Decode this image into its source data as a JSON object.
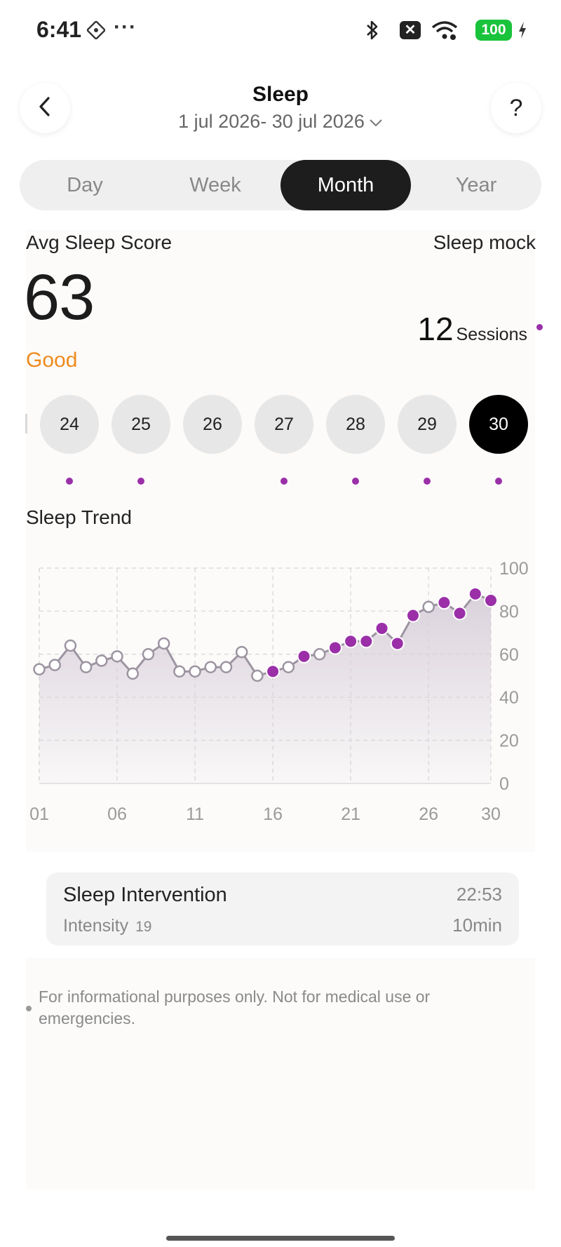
{
  "status_bar": {
    "time": "6:41",
    "more": "···",
    "battery": "100"
  },
  "header": {
    "title": "Sleep",
    "date_range": "1 jul 2026- 30 jul 2026",
    "help": "?"
  },
  "tabs": [
    {
      "label": "Day",
      "active": false
    },
    {
      "label": "Week",
      "active": false
    },
    {
      "label": "Month",
      "active": true
    },
    {
      "label": "Year",
      "active": false
    }
  ],
  "summary": {
    "avg_label": "Avg Sleep Score",
    "mode_label": "Sleep mock",
    "score": "63",
    "rating": "Good",
    "sessions_count": "12",
    "sessions_label": "Sessions"
  },
  "days": [
    {
      "label": "24",
      "has_session": true,
      "active": false
    },
    {
      "label": "25",
      "has_session": true,
      "active": false
    },
    {
      "label": "26",
      "has_session": false,
      "active": false
    },
    {
      "label": "27",
      "has_session": true,
      "active": false
    },
    {
      "label": "28",
      "has_session": true,
      "active": false
    },
    {
      "label": "29",
      "has_session": true,
      "active": false
    },
    {
      "label": "30",
      "has_session": true,
      "active": true
    }
  ],
  "trend_title": "Sleep Trend",
  "chart_data": {
    "type": "area",
    "x": [
      1,
      2,
      3,
      4,
      5,
      6,
      7,
      8,
      9,
      10,
      11,
      12,
      13,
      14,
      15,
      16,
      17,
      18,
      19,
      20,
      21,
      22,
      23,
      24,
      25,
      26,
      27,
      28,
      29,
      30
    ],
    "values": [
      53,
      55,
      64,
      54,
      57,
      59,
      51,
      60,
      65,
      52,
      52,
      54,
      54,
      61,
      50,
      52,
      54,
      59,
      60,
      63,
      66,
      66,
      72,
      65,
      78,
      82,
      84,
      79,
      88,
      85
    ],
    "session": [
      false,
      false,
      false,
      false,
      false,
      false,
      false,
      false,
      false,
      false,
      false,
      false,
      false,
      false,
      false,
      true,
      false,
      true,
      false,
      true,
      true,
      true,
      true,
      true,
      true,
      false,
      true,
      true,
      true,
      true
    ],
    "x_tick_labels": [
      "01",
      "06",
      "11",
      "16",
      "21",
      "26",
      "30"
    ],
    "x_tick_positions": [
      1,
      6,
      11,
      16,
      21,
      26,
      30
    ],
    "y_ticks": [
      0,
      20,
      40,
      60,
      80,
      100
    ],
    "ylim": [
      0,
      100
    ],
    "grid": true,
    "colors": {
      "line": "#9d94a1",
      "session_point": "#9a2fa8",
      "hollow_point": "#ffffff",
      "fill": "#d8d0da"
    }
  },
  "intervention": {
    "title": "Sleep Intervention",
    "intensity_label": "Intensity",
    "intensity_value": "19",
    "time": "22:53",
    "duration": "10min"
  },
  "disclaimer": "For informational purposes only. Not for medical use or emergencies.",
  "colors": {
    "accent": "#9a2fa8",
    "rating": "#ef8a1c",
    "active_tab": "#1d1d1d",
    "battery": "#19c33c"
  }
}
